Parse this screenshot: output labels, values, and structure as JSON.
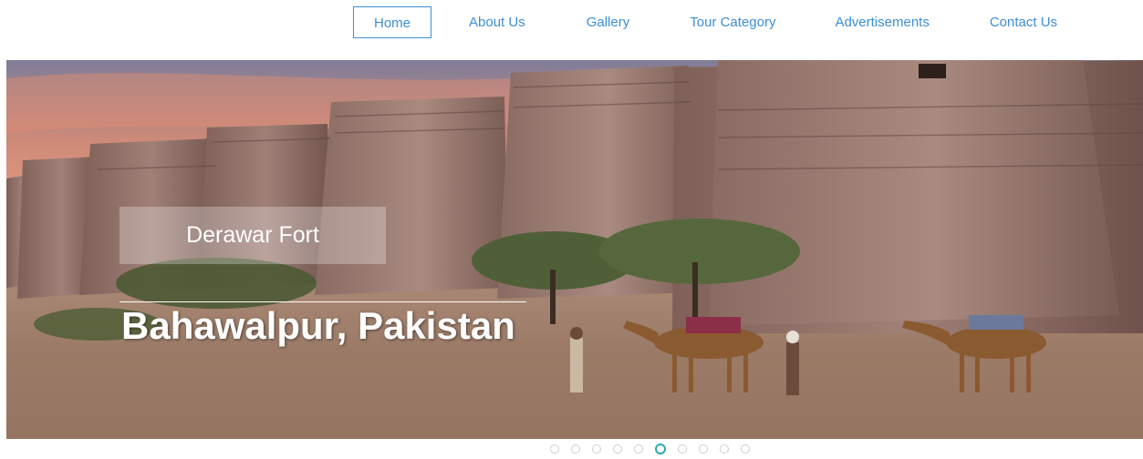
{
  "nav": {
    "items": [
      {
        "label": "Home",
        "active": true
      },
      {
        "label": "About Us",
        "active": false
      },
      {
        "label": "Gallery",
        "active": false
      },
      {
        "label": "Tour Category",
        "active": false
      },
      {
        "label": "Advertisements",
        "active": false
      },
      {
        "label": "Contact Us",
        "active": false
      }
    ]
  },
  "hero": {
    "caption": "Derawar Fort",
    "title": "Bahawalpur, Pakistan"
  },
  "slider": {
    "slide_count": 10,
    "active_index": 5
  },
  "colors": {
    "nav_link": "#3b8fd6",
    "active_dot": "#2aa8b5"
  }
}
